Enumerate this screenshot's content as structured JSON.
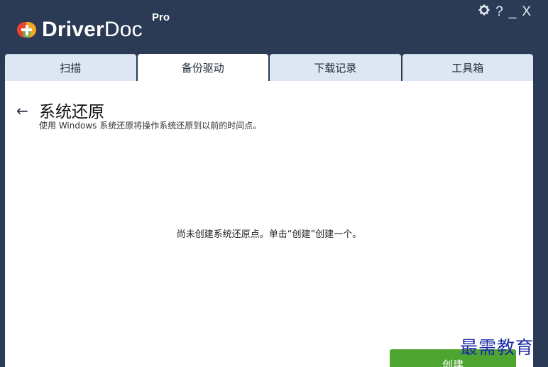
{
  "app": {
    "name_bold": "Driver",
    "name_light": "Doc",
    "edition": "Pro"
  },
  "window_controls": {
    "settings_icon": "gear-icon",
    "help": "?",
    "minimize": "_",
    "close": "X"
  },
  "tabs": [
    {
      "label": "扫描",
      "active": false
    },
    {
      "label": "备份驱动",
      "active": true
    },
    {
      "label": "下载记录",
      "active": false
    },
    {
      "label": "工具箱",
      "active": false
    }
  ],
  "page": {
    "back_icon": "←",
    "title": "系统还原",
    "subtitle": "使用 Windows 系统还原将操作系统还原到以前的时间点。",
    "empty_message": "尚未创建系统还原点。单击“创建”创建一个。",
    "create_button": "创建"
  },
  "watermark": "最需教育",
  "colors": {
    "titlebar": "#2c3b55",
    "tab_inactive": "#dce7f3",
    "accent_green": "#4ea52f",
    "logo_red": "#e8452c",
    "logo_orange": "#f5a623"
  }
}
